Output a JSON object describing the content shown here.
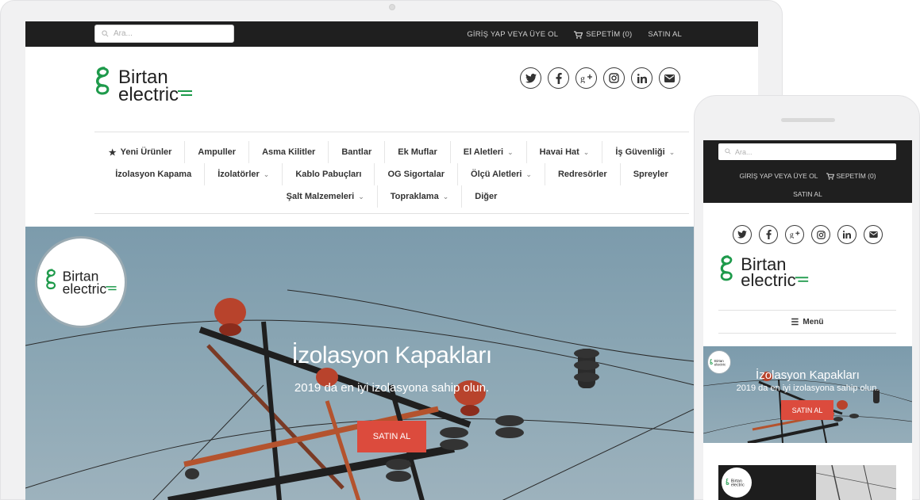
{
  "brand": {
    "line1": "Birtan",
    "line2": "electric",
    "color": "#1e9a4b"
  },
  "topbar": {
    "search_placeholder": "Ara...",
    "login_label": "GİRİŞ YAP VEYA ÜYE OL",
    "cart_label": "SEPETİM (0)",
    "buy_label": "SATIN AL"
  },
  "social_icons": [
    "twitter-icon",
    "facebook-icon",
    "google-plus-icon",
    "instagram-icon",
    "linkedin-icon",
    "mail-icon"
  ],
  "nav": {
    "row1": [
      {
        "label": "Yeni Ürünler",
        "star": true
      },
      {
        "label": "Ampuller"
      },
      {
        "label": "Asma Kilitler"
      },
      {
        "label": "Bantlar"
      },
      {
        "label": "Ek Muflar"
      },
      {
        "label": "El Aletleri",
        "dropdown": true
      },
      {
        "label": "Havai Hat",
        "dropdown": true
      },
      {
        "label": "İş Güvenliği",
        "dropdown": true
      }
    ],
    "row2": [
      {
        "label": "İzolasyon Kapama"
      },
      {
        "label": "İzolatörler",
        "dropdown": true
      },
      {
        "label": "Kablo Pabuçları"
      },
      {
        "label": "OG Sigortalar"
      },
      {
        "label": "Ölçü Aletleri",
        "dropdown": true
      },
      {
        "label": "Redresörler"
      },
      {
        "label": "Spreyler"
      }
    ],
    "row3": [
      {
        "label": "Şalt Malzemeleri",
        "dropdown": true
      },
      {
        "label": "Topraklama",
        "dropdown": true
      },
      {
        "label": "Diğer"
      }
    ]
  },
  "hero": {
    "title": "İzolasyon Kapakları",
    "subtitle": "2019 da en iyi izolasyona sahip olun.",
    "button_label": "SATIN AL",
    "button_color": "#dc4b3d"
  },
  "mobile": {
    "search_placeholder": "Ara...",
    "login_label": "GİRİŞ YAP VEYA ÜYE OL",
    "cart_label": "SEPETİM (0)",
    "buy_label": "SATIN AL",
    "menu_label": "Menü",
    "hero_title": "İzolasyon Kapakları",
    "hero_subtitle": "2019 da en iyi izolasyona sahip olun.",
    "hero_button": "SATIN AL"
  }
}
